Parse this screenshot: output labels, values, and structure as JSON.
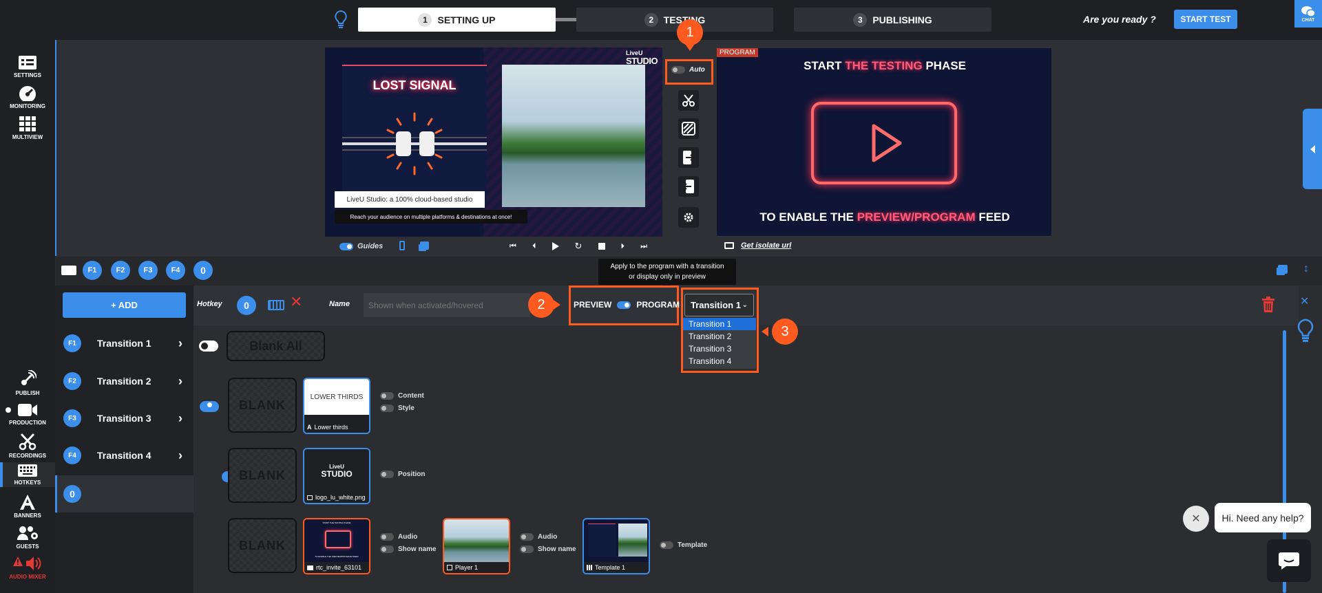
{
  "steps": [
    {
      "num": "1",
      "label": "SETTING UP"
    },
    {
      "num": "2",
      "label": "TESTING"
    },
    {
      "num": "3",
      "label": "PUBLISHING"
    }
  ],
  "header": {
    "ready_text": "Are you ready ?",
    "start_test": "START TEST",
    "chat": "CHAT"
  },
  "nav_top": [
    {
      "label": "SETTINGS",
      "icon": "settings-icon"
    },
    {
      "label": "MONITORING",
      "icon": "monitoring-icon"
    },
    {
      "label": "MULTIVIEW",
      "icon": "multiview-icon"
    }
  ],
  "nav_bottom": [
    {
      "label": "PUBLISH",
      "icon": "publish-icon"
    },
    {
      "label": "PRODUCTION",
      "icon": "production-icon"
    },
    {
      "label": "RECORDINGS",
      "icon": "recordings-icon"
    },
    {
      "label": "HOTKEYS",
      "icon": "hotkeys-icon"
    },
    {
      "label": "BANNERS",
      "icon": "banners-icon"
    },
    {
      "label": "GUESTS",
      "icon": "guests-icon"
    },
    {
      "label": "AUDIO MIXER",
      "icon": "audio-mixer-icon"
    }
  ],
  "preview": {
    "logo_top": "LiveU",
    "logo_bottom": "STUDIO",
    "lost_signal": "LOST SIGNAL",
    "lower_title": "LiveU Studio: a 100% cloud-based studio",
    "lower_sub": "Reach your audience on multiple platforms & destinations at once!",
    "guides_label": "Guides"
  },
  "auto_label": "Auto",
  "program": {
    "tag": "PROGRAM",
    "line1_a": "START ",
    "line1_b": "THE TESTING",
    "line1_c": " PHASE",
    "line2_a": "TO ENABLE THE ",
    "line2_b": "PREVIEW/PROGRAM",
    "line2_c": " FEED",
    "isolate": "Get isolate url"
  },
  "hotkey_keys": [
    "F1",
    "F2",
    "F3",
    "F4",
    "0"
  ],
  "tooltip": {
    "line1": "Apply to the program with a transition",
    "line2": "or display only in preview"
  },
  "editor": {
    "add_label": "+ ADD",
    "hotkey_label": "Hotkey",
    "hotkey_value": "0",
    "name_label": "Name",
    "name_placeholder": "Shown when activated/hovered",
    "preview_label": "PREVIEW",
    "program_label": "PROGRAM",
    "selected_transition": "Transition 1",
    "options": [
      "Transition 1",
      "Transition 2",
      "Transition 3",
      "Transition 4"
    ]
  },
  "transitions": [
    {
      "key": "F1",
      "label": "Transition 1"
    },
    {
      "key": "F2",
      "label": "Transition 2"
    },
    {
      "key": "F3",
      "label": "Transition 3"
    },
    {
      "key": "F4",
      "label": "Transition 4"
    },
    {
      "key": "0",
      "label": ""
    }
  ],
  "blank_all": "Blank All",
  "blank": "BLANK",
  "rows": {
    "r1": {
      "tile_title": "LOWER THIRDS",
      "tile_caption": "Lower thirds",
      "opt1": "Content",
      "opt2": "Style"
    },
    "r2": {
      "tile_caption": "logo_lu_white.png",
      "opt1": "Position"
    },
    "r3": {
      "t1_caption": "rtc_invite_63101",
      "t1_top": "START THE TESTING PHASE",
      "t1_bottom": "TO ENABLE THE PREVIEW/PROGRAM FEED",
      "t1_o1": "Audio",
      "t1_o2": "Show name",
      "t2_caption": "Player 1",
      "t2_o1": "Audio",
      "t2_o2": "Show name",
      "t3_caption": "Template 1",
      "t3_o1": "Template"
    }
  },
  "badges": {
    "b1": "1",
    "b2": "2",
    "b3": "3"
  },
  "help": {
    "text": "Hi. Need any help?"
  },
  "colors": {
    "accent": "#3b8eea",
    "highlight": "#ff5a1f",
    "danger": "#e53935"
  }
}
